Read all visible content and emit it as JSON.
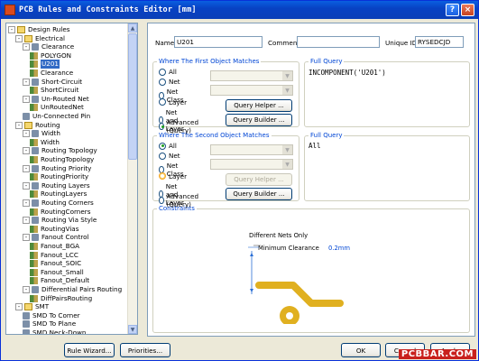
{
  "window": {
    "title": "PCB Rules and Constraints Editor [mm]"
  },
  "tree": {
    "items": [
      {
        "label": "Design Rules",
        "glyph": "-",
        "icon": "folder"
      },
      {
        "label": "Electrical",
        "glyph": "-",
        "icon": "folder"
      },
      {
        "label": "Clearance",
        "glyph": "-",
        "icon": "rule"
      },
      {
        "label": "POLYGON",
        "glyph": "",
        "icon": "sub"
      },
      {
        "label": "U201",
        "glyph": "",
        "icon": "sub",
        "selected": true
      },
      {
        "label": "Clearance",
        "glyph": "",
        "icon": "sub"
      },
      {
        "label": "Short-Circuit",
        "glyph": "-",
        "icon": "rule"
      },
      {
        "label": "ShortCircuit",
        "glyph": "",
        "icon": "sub"
      },
      {
        "label": "Un-Routed Net",
        "glyph": "-",
        "icon": "rule"
      },
      {
        "label": "UnRoutedNet",
        "glyph": "",
        "icon": "sub"
      },
      {
        "label": "Un-Connected Pin",
        "glyph": "",
        "icon": "rule"
      },
      {
        "label": "Routing",
        "glyph": "-",
        "icon": "folder"
      },
      {
        "label": "Width",
        "glyph": "-",
        "icon": "rule"
      },
      {
        "label": "Width",
        "glyph": "",
        "icon": "sub"
      },
      {
        "label": "Routing Topology",
        "glyph": "-",
        "icon": "rule"
      },
      {
        "label": "RoutingTopology",
        "glyph": "",
        "icon": "sub"
      },
      {
        "label": "Routing Priority",
        "glyph": "-",
        "icon": "rule"
      },
      {
        "label": "RoutingPriority",
        "glyph": "",
        "icon": "sub"
      },
      {
        "label": "Routing Layers",
        "glyph": "-",
        "icon": "rule"
      },
      {
        "label": "RoutingLayers",
        "glyph": "",
        "icon": "sub"
      },
      {
        "label": "Routing Corners",
        "glyph": "-",
        "icon": "rule"
      },
      {
        "label": "RoutingCorners",
        "glyph": "",
        "icon": "sub"
      },
      {
        "label": "Routing Via Style",
        "glyph": "-",
        "icon": "rule"
      },
      {
        "label": "RoutingVias",
        "glyph": "",
        "icon": "sub"
      },
      {
        "label": "Fanout Control",
        "glyph": "-",
        "icon": "rule"
      },
      {
        "label": "Fanout_BGA",
        "glyph": "",
        "icon": "sub"
      },
      {
        "label": "Fanout_LCC",
        "glyph": "",
        "icon": "sub"
      },
      {
        "label": "Fanout_SOIC",
        "glyph": "",
        "icon": "sub"
      },
      {
        "label": "Fanout_Small",
        "glyph": "",
        "icon": "sub"
      },
      {
        "label": "Fanout_Default",
        "glyph": "",
        "icon": "sub"
      },
      {
        "label": "Differential Pairs Routing",
        "glyph": "-",
        "icon": "rule"
      },
      {
        "label": "DiffPairsRouting",
        "glyph": "",
        "icon": "sub"
      },
      {
        "label": "SMT",
        "glyph": "-",
        "icon": "folder"
      },
      {
        "label": "SMD To Corner",
        "glyph": "",
        "icon": "rule"
      },
      {
        "label": "SMD To Plane",
        "glyph": "",
        "icon": "rule"
      },
      {
        "label": "SMD Neck-Down",
        "glyph": "",
        "icon": "rule"
      }
    ]
  },
  "rule": {
    "name_label": "Name",
    "name_value": "U201",
    "comment_label": "Comment",
    "comment_value": "",
    "uid_label": "Unique ID",
    "uid_value": "RYSEDCJD"
  },
  "first": {
    "title": "Where The First Object Matches",
    "options": [
      "All",
      "Net",
      "Net Class",
      "Layer",
      "Net and Layer",
      "Advanced (Query)"
    ],
    "selected": "Advanced (Query)",
    "query_helper": "Query Helper ...",
    "query_builder": "Query Builder ...",
    "full_query_label": "Full Query",
    "full_query": "INCOMPONENT('U201')"
  },
  "second": {
    "title": "Where The Second Object Matches",
    "options": [
      "All",
      "Net",
      "Net Class",
      "Layer",
      "Net and Layer",
      "Advanced (Query)"
    ],
    "selected": "All",
    "query_helper": "Query Helper ...",
    "query_builder": "Query Builder ...",
    "full_query_label": "Full Query",
    "full_query": "All"
  },
  "constraints": {
    "title": "Constraints",
    "different_nets": "Different Nets Only",
    "min_clearance_label": "Minimum Clearance",
    "min_clearance_value": "0.2mm"
  },
  "footer": {
    "rule_wizard": "Rule Wizard...",
    "priorities": "Priorities...",
    "ok": "OK",
    "cancel": "Cancel",
    "apply": "Apply"
  },
  "watermark": "PCBBAR.COM",
  "colors": {
    "titlebar": "#0842c4",
    "selection": "#316ac5",
    "group_title": "#0046d5",
    "pad": "#e0b020"
  }
}
